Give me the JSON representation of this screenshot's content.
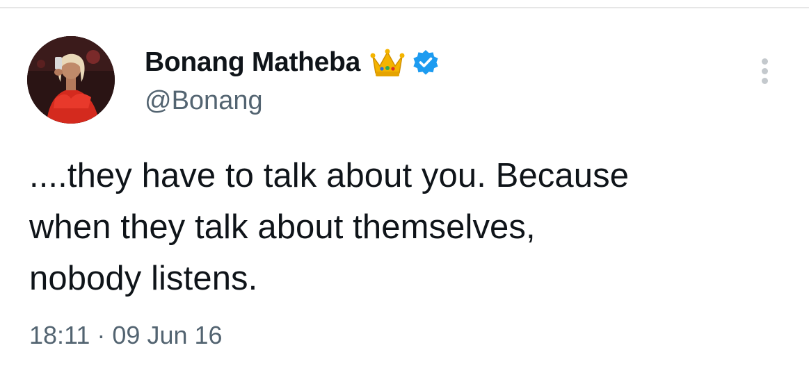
{
  "author": {
    "display_name": "Bonang Matheba",
    "handle": "@Bonang",
    "badges": [
      "crown-icon",
      "verified-icon"
    ],
    "verified_color": "#1d9bf0",
    "crown_color": "#f4b400"
  },
  "tweet": {
    "lines": [
      "....they have to talk about you. Because",
      "when they talk about themselves,",
      "nobody listens."
    ],
    "timestamp": "18:11 · 09 Jun 16"
  },
  "menu": {
    "icon": "more-vertical-icon"
  },
  "colors": {
    "text": "#0f1419",
    "secondary_text": "#536471",
    "background": "#ffffff"
  }
}
